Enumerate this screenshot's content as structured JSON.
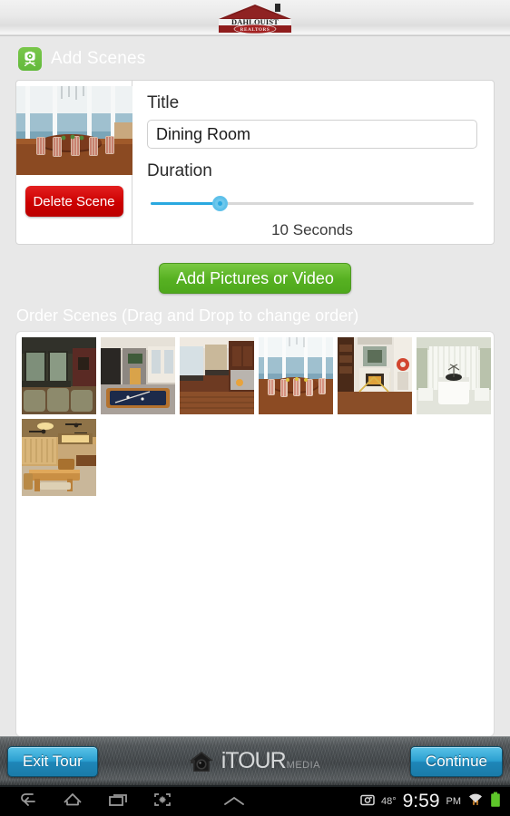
{
  "brand": {
    "logo_name": "dahlquist-realtors-logo",
    "primary_text": "DAHLQUIST",
    "badge_text": "REALTORS",
    "color": "#8f1d1d"
  },
  "header": {
    "title": "Add Scenes",
    "icon": "projector-icon",
    "icon_bg": "#62b93b"
  },
  "scene": {
    "thumbnail_name": "scene-thumbnail-dining-room",
    "delete_label": "Delete Scene",
    "delete_color": "#cc0000",
    "title_label": "Title",
    "title_value": "Dining Room",
    "title_placeholder": "Scene Title",
    "duration_label": "Duration",
    "duration_value": "10 Seconds",
    "duration_seconds": 10,
    "slider_percent": 22,
    "slider_color": "#2aa8e0"
  },
  "actions": {
    "add_media_label": "Add Pictures or Video",
    "add_media_color": "#57b122"
  },
  "order": {
    "label": "Order Scenes (Drag and Drop to change order)",
    "thumbnails": [
      {
        "name": "thumb-theater-room",
        "alt": "Theater room with green walls and recliner seating"
      },
      {
        "name": "thumb-game-room",
        "alt": "Game room with pool table and stone fireplace"
      },
      {
        "name": "thumb-kitchen",
        "alt": "Kitchen with dark wood cabinets and stainless range"
      },
      {
        "name": "thumb-dining-room-waterfront",
        "alt": "Waterfront dining room with striped chairs"
      },
      {
        "name": "thumb-stair-hall",
        "alt": "Stair hall with fireplace and artwork"
      },
      {
        "name": "thumb-bathroom",
        "alt": "Bathroom with sheer curtains and white vanity"
      },
      {
        "name": "thumb-dining-room-warm",
        "alt": "Warm lit dining room with ceiling fans"
      }
    ]
  },
  "footer": {
    "exit_label": "Exit Tour",
    "continue_label": "Continue",
    "logo_i": "i",
    "logo_tour": "TOUR",
    "logo_media": "MEDIA",
    "logo_name": "itour-media-logo",
    "button_color": "#2b9fd0"
  },
  "statusbar": {
    "nav": [
      "back-icon",
      "home-icon",
      "recents-icon",
      "screenshot-icon",
      "expand-up-icon"
    ],
    "screenshot_icon": "camera-icon",
    "temperature": "48°",
    "clock": "9:59",
    "ampm": "PM",
    "wifi_icon": "wifi-icon",
    "battery_icon": "battery-full-icon",
    "battery_color": "#5ec72a"
  }
}
